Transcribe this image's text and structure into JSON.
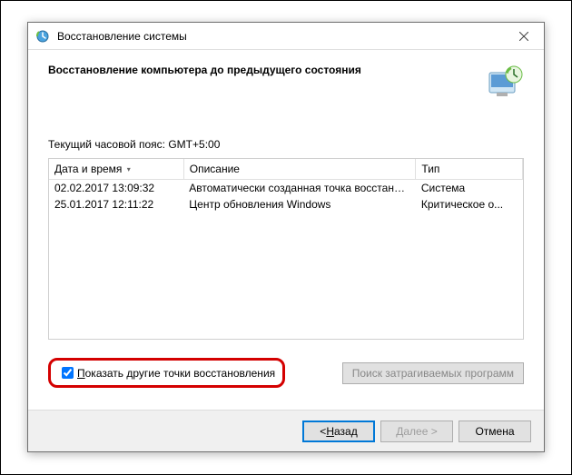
{
  "titlebar": {
    "title": "Восстановление системы"
  },
  "header": {
    "heading": "Восстановление компьютера до предыдущего состояния"
  },
  "timezone_label": "Текущий часовой пояс: GMT+5:00",
  "table": {
    "columns": {
      "date": "Дата и время",
      "description": "Описание",
      "type": "Тип"
    },
    "rows": [
      {
        "date": "02.02.2017 13:09:32",
        "description": "Автоматически созданная точка восстановле...",
        "type": "Система"
      },
      {
        "date": "25.01.2017 12:11:22",
        "description": "Центр обновления Windows",
        "type": "Критическое о..."
      }
    ]
  },
  "checkbox": {
    "prefix": "П",
    "rest": "оказать другие точки восстановления",
    "checked": true
  },
  "scan_button": "Поиск затрагиваемых программ",
  "footer": {
    "back_prefix": "< ",
    "back_u": "Н",
    "back_rest": "азад",
    "next_u": "Д",
    "next_rest": "алее >",
    "cancel": "Отмена"
  }
}
